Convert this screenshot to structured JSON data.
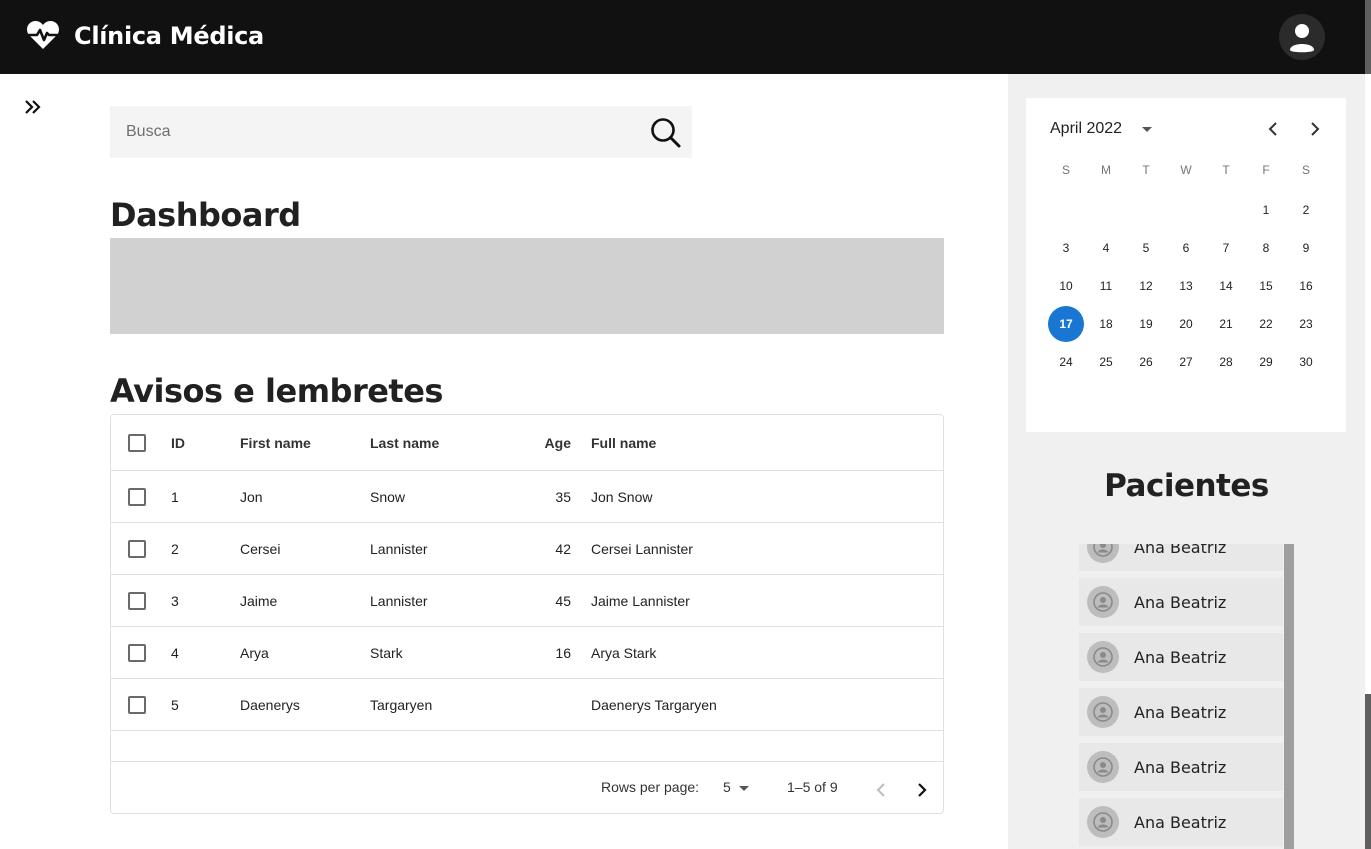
{
  "app": {
    "title": "Clínica Médica",
    "logo_icon": "heart-pulse-icon",
    "avatar_icon": "user-icon",
    "colors": {
      "topbar": "#111111",
      "accent": "#1976d2",
      "side_panel": "#f0f0f0"
    }
  },
  "sidebar": {
    "expand_icon": "double-chevron-right-icon"
  },
  "search": {
    "placeholder": "Busca",
    "value": "",
    "icon": "search-icon"
  },
  "dashboard": {
    "title": "Dashboard"
  },
  "reminders": {
    "title": "Avisos e lembretes",
    "columns": [
      "ID",
      "First name",
      "Last name",
      "Age",
      "Full name"
    ],
    "rows": [
      {
        "id": "1",
        "first": "Jon",
        "last": "Snow",
        "age": "35",
        "full": "Jon Snow"
      },
      {
        "id": "2",
        "first": "Cersei",
        "last": "Lannister",
        "age": "42",
        "full": "Cersei Lannister"
      },
      {
        "id": "3",
        "first": "Jaime",
        "last": "Lannister",
        "age": "45",
        "full": "Jaime Lannister"
      },
      {
        "id": "4",
        "first": "Arya",
        "last": "Stark",
        "age": "16",
        "full": "Arya Stark"
      },
      {
        "id": "5",
        "first": "Daenerys",
        "last": "Targaryen",
        "age": "",
        "full": "Daenerys Targaryen"
      }
    ],
    "footer": {
      "rows_per_page_label": "Rows per page:",
      "rows_per_page_value": "5",
      "range": "1–5 of 9"
    }
  },
  "calendar": {
    "month_label": "April 2022",
    "weekdays": [
      "S",
      "M",
      "T",
      "W",
      "T",
      "F",
      "S"
    ],
    "first_weekday_index": 5,
    "days_in_month": 30,
    "selected_day": 17
  },
  "patients": {
    "title": "Pacientes",
    "items": [
      {
        "name": "Ana Beatriz"
      },
      {
        "name": "Ana Beatriz"
      },
      {
        "name": "Ana Beatriz"
      },
      {
        "name": "Ana Beatriz"
      },
      {
        "name": "Ana Beatriz"
      },
      {
        "name": "Ana Beatriz"
      }
    ]
  }
}
